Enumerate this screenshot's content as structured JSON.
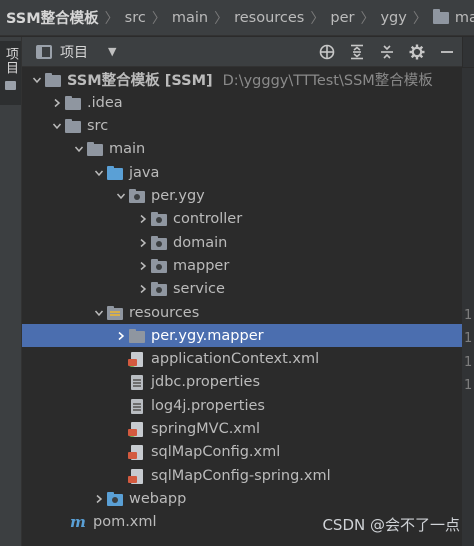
{
  "breadcrumb": {
    "items": [
      "SSM整合模板",
      "src",
      "main",
      "resources",
      "per",
      "ygy",
      "mapper"
    ]
  },
  "stripe": {
    "tab_label": "项目"
  },
  "panel": {
    "title": "项目",
    "actions": [
      "locate-icon",
      "expand-all-icon",
      "collapse-all-icon",
      "gear-icon",
      "minimize-icon"
    ]
  },
  "tree": {
    "rows": [
      {
        "label": "SSM整合模板 [SSM]",
        "path": "D:\\ygggy\\TTTest\\SSM整合模板",
        "icon": "module-folder",
        "expanded": true
      },
      {
        "label": ".idea",
        "icon": "folder",
        "expanded": false
      },
      {
        "label": "src",
        "icon": "folder",
        "expanded": true
      },
      {
        "label": "main",
        "icon": "folder",
        "expanded": true
      },
      {
        "label": "java",
        "icon": "source-folder",
        "expanded": true
      },
      {
        "label": "per.ygy",
        "icon": "package",
        "expanded": true
      },
      {
        "label": "controller",
        "icon": "package",
        "expanded": false
      },
      {
        "label": "domain",
        "icon": "package",
        "expanded": false
      },
      {
        "label": "mapper",
        "icon": "package",
        "expanded": false
      },
      {
        "label": "service",
        "icon": "package",
        "expanded": false
      },
      {
        "label": "resources",
        "icon": "resources-folder",
        "expanded": true
      },
      {
        "label": "per.ygy.mapper",
        "icon": "folder",
        "expanded": false,
        "selected": true
      },
      {
        "label": "applicationContext.xml",
        "icon": "spring-xml"
      },
      {
        "label": "jdbc.properties",
        "icon": "properties"
      },
      {
        "label": "log4j.properties",
        "icon": "properties"
      },
      {
        "label": "springMVC.xml",
        "icon": "spring-xml"
      },
      {
        "label": "sqlMapConfig.xml",
        "icon": "xml"
      },
      {
        "label": "sqlMapConfig-spring.xml",
        "icon": "xml"
      },
      {
        "label": "webapp",
        "icon": "web-folder",
        "expanded": false
      },
      {
        "label": "pom.xml",
        "icon": "maven"
      }
    ]
  },
  "gutter": {
    "numbers": [
      "1",
      "1",
      "1",
      "1"
    ]
  },
  "watermark": "CSDN @会不了一点"
}
